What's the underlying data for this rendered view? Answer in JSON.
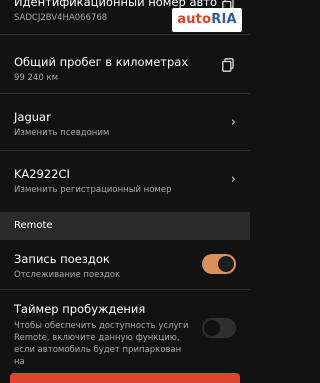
{
  "vin": {
    "title": "Идентификационный номер авто",
    "value": "SADCJ2BV4HA066768",
    "icon": "copy-icon"
  },
  "mileage": {
    "title": "Общий пробег в километрах",
    "value": "99 240 км",
    "icon": "copy-icon"
  },
  "alias": {
    "title": "Jaguar",
    "subtitle": "Изменить псевдоним",
    "icon": "chevron-right-icon"
  },
  "plate": {
    "title": "KA2922CI",
    "subtitle": "Изменить регистрационный номер",
    "icon": "chevron-right-icon"
  },
  "section": {
    "label": "Remote"
  },
  "trip_recording": {
    "title": "Запись поездок",
    "subtitle": "Отслеживание поездок",
    "enabled": true
  },
  "wake_timer": {
    "title": "Таймер пробуждения",
    "description": "Чтобы обеспечить доступность услуги Remote, включите данную функцию, если автомобиль будет припаркован на",
    "enabled": false
  },
  "watermark": {
    "part1": "auto",
    "part2": "RIA"
  },
  "colors": {
    "background": "#121212",
    "accent": "#d9915a",
    "section_bg": "#2a2a2a",
    "bar": "#e0442c"
  }
}
